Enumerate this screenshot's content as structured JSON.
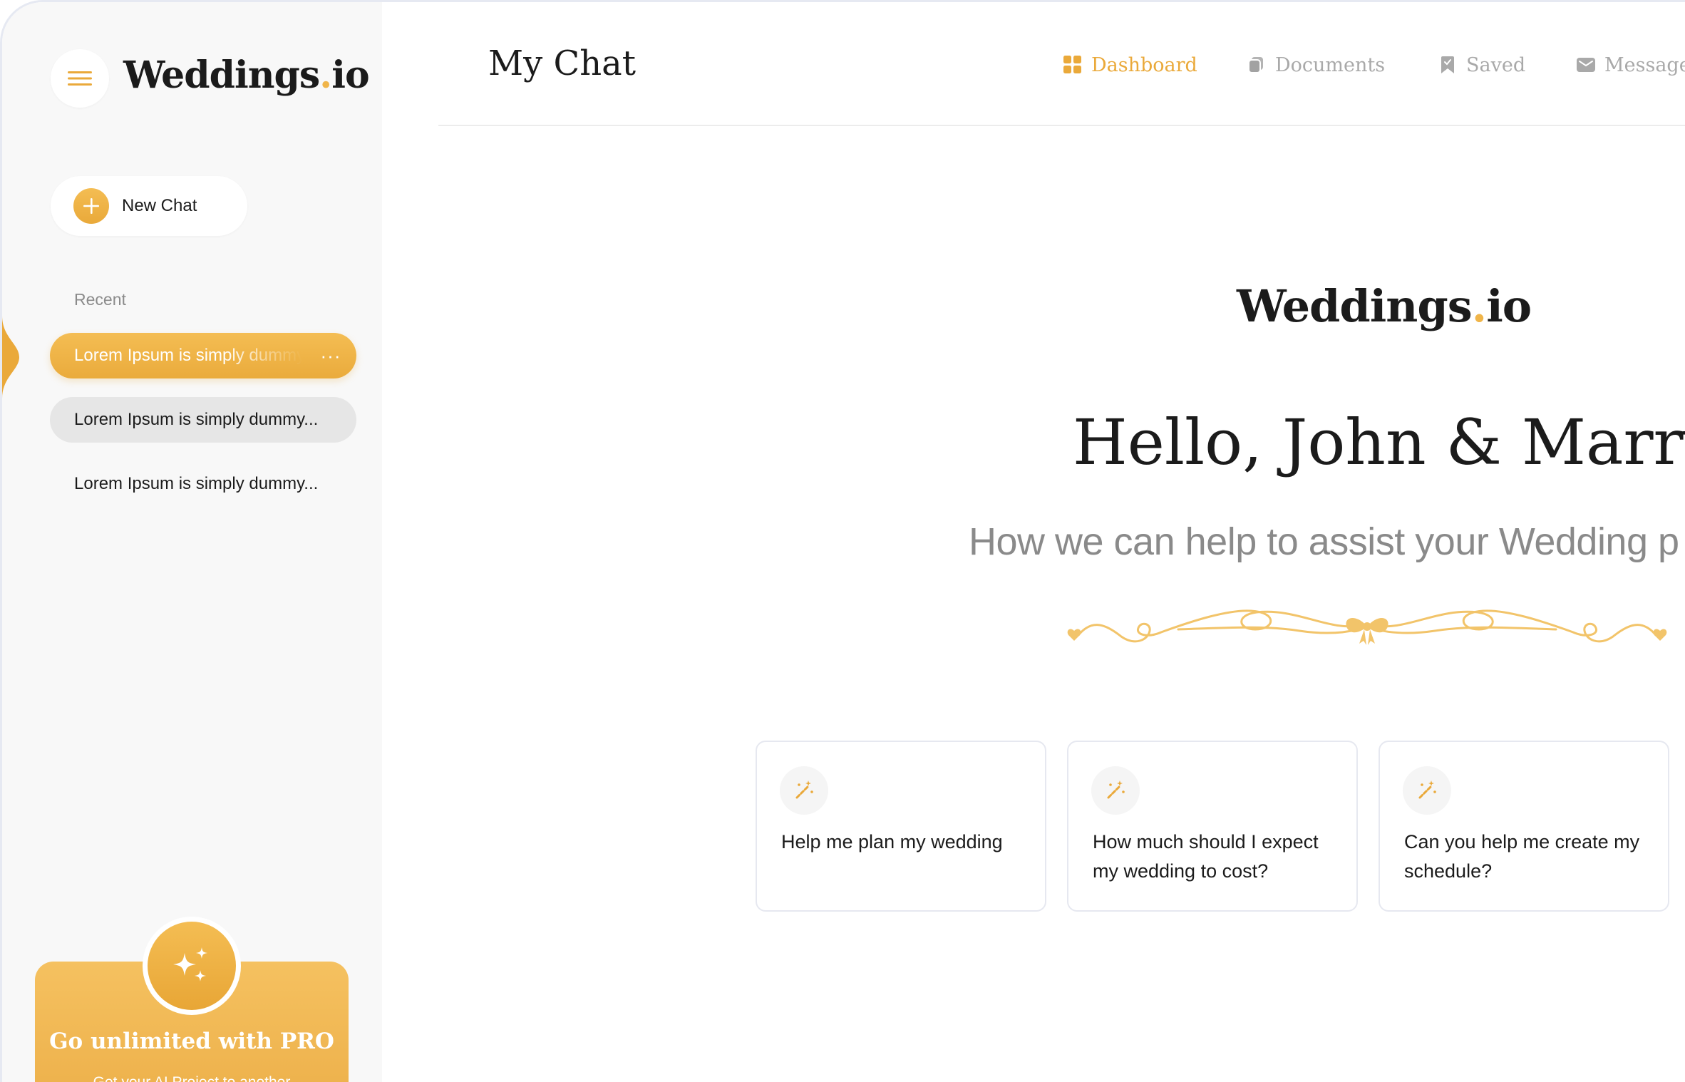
{
  "brand": {
    "name": "Weddings",
    "dot": ".",
    "suffix": "io"
  },
  "sidebar": {
    "new_chat_label": "New Chat",
    "recent_label": "Recent",
    "recent_items": [
      {
        "label": "Lorem Ipsum is simply dummy",
        "state": "active",
        "more": "···"
      },
      {
        "label": "Lorem Ipsum is simply dummy...",
        "state": "hover"
      },
      {
        "label": "Lorem Ipsum is simply dummy...",
        "state": "normal"
      }
    ],
    "pro": {
      "title": "Go unlimited with PRO",
      "subtitle": "Get your AI Project to another"
    }
  },
  "header": {
    "title": "My Chat",
    "nav": [
      {
        "label": "Dashboard",
        "icon": "grid-icon",
        "active": true
      },
      {
        "label": "Documents",
        "icon": "documents-icon",
        "active": false
      },
      {
        "label": "Saved",
        "icon": "bookmark-icon",
        "active": false
      },
      {
        "label": "Message",
        "icon": "mail-icon",
        "active": false
      }
    ]
  },
  "hero": {
    "greeting": "Hello, John & Marry",
    "subtitle": "How we can help to assist your Wedding p"
  },
  "prompts": [
    {
      "text": "Help me plan my wedding",
      "icon": "magic-wand-icon"
    },
    {
      "text": "How much should I expect my wedding to cost?",
      "icon": "magic-wand-icon"
    },
    {
      "text": "Can you help me create my schedule?",
      "icon": "magic-wand-icon"
    }
  ],
  "colors": {
    "accent": "#eaa93a",
    "accent_light": "#f4bd53",
    "sidebar_bg": "#f8f8f8",
    "nav_inactive": "#a9a9a9"
  }
}
